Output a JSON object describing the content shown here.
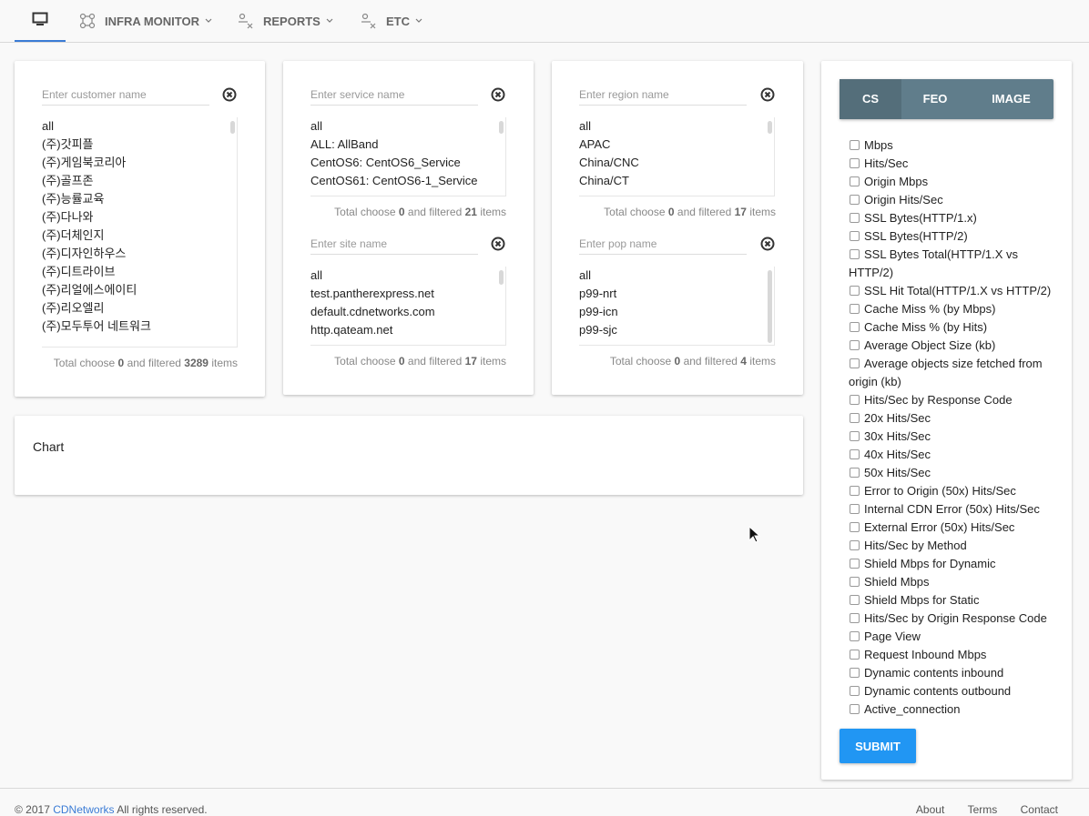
{
  "nav": {
    "home_icon": "monitor-icon",
    "items": [
      {
        "label": "INFRA MONITOR",
        "icon": "network-icon"
      },
      {
        "label": "REPORTS",
        "icon": "reports-icon"
      },
      {
        "label": "ETC",
        "icon": "etc-icon"
      }
    ],
    "accent": "#3a7bd5"
  },
  "customer": {
    "placeholder": "Enter customer name",
    "items": [
      "all",
      "(주)갓피플",
      "(주)게임북코리아",
      "(주)골프존",
      "(주)능률교육",
      "(주)다나와",
      "(주)더체인지",
      "(주)디자인하우스",
      "(주)디트라이브",
      "(주)리얼에스에이티",
      "(주)리오엘리",
      "(주)모두투어 네트워크"
    ],
    "footer_prefix": "Total choose",
    "chosen": "0",
    "footer_mid": "and filtered",
    "filtered": "3289",
    "footer_suffix": "items"
  },
  "service": {
    "placeholder": "Enter service name",
    "items": [
      "all",
      "ALL: AllBand",
      "CentOS6: CentOS6_Service",
      "CentOS61: CentOS6-1_Service"
    ],
    "footer_prefix": "Total choose",
    "chosen": "0",
    "footer_mid": "and filtered",
    "filtered": "21",
    "footer_suffix": "items"
  },
  "site": {
    "placeholder": "Enter site name",
    "items": [
      "all",
      "test.pantherexpress.net",
      "default.cdnetworks.com",
      "http.qateam.net"
    ],
    "footer_prefix": "Total choose",
    "chosen": "0",
    "footer_mid": "and filtered",
    "filtered": "17",
    "footer_suffix": "items"
  },
  "region": {
    "placeholder": "Enter region name",
    "items": [
      "all",
      "APAC",
      "China/CNC",
      "China/CT"
    ],
    "footer_prefix": "Total choose",
    "chosen": "0",
    "footer_mid": "and filtered",
    "filtered": "17",
    "footer_suffix": "items"
  },
  "pop": {
    "placeholder": "Enter pop name",
    "items": [
      "all",
      "p99-nrt",
      "p99-icn",
      "p99-sjc"
    ],
    "footer_prefix": "Total choose",
    "chosen": "0",
    "footer_mid": "and filtered",
    "filtered": "4",
    "footer_suffix": "items"
  },
  "chart": {
    "title": "Chart"
  },
  "tabs": [
    "CS",
    "FEO",
    "IMAGE"
  ],
  "tab_colors": {
    "bar": "#607d8b",
    "active": "#546e7a"
  },
  "metrics": [
    "Mbps",
    "Hits/Sec",
    "Origin Mbps",
    "Origin Hits/Sec",
    "SSL Bytes(HTTP/1.x)",
    "SSL Bytes(HTTP/2)",
    "SSL Bytes Total(HTTP/1.X vs HTTP/2)",
    "SSL Hit Total(HTTP/1.X vs HTTP/2)",
    "Cache Miss % (by Mbps)",
    "Cache Miss % (by Hits)",
    "Average Object Size (kb)",
    "Average objects size fetched from origin (kb)",
    "Hits/Sec by Response Code",
    "20x Hits/Sec",
    "30x Hits/Sec",
    "40x Hits/Sec",
    "50x Hits/Sec",
    "Error to Origin (50x) Hits/Sec",
    "Internal CDN Error (50x) Hits/Sec",
    "External Error (50x) Hits/Sec",
    "Hits/Sec by Method",
    "Shield Mbps for Dynamic",
    "Shield Mbps",
    "Shield Mbps for Static",
    "Hits/Sec by Origin Response Code",
    "Page View",
    "Request Inbound Mbps",
    "Dynamic contents inbound",
    "Dynamic contents outbound",
    "Active_connection"
  ],
  "submit_label": "SUBMIT",
  "submit_color": "#2196f3",
  "footer": {
    "copyright_prefix": "© 2017",
    "company": "CDNetworks",
    "copyright_suffix": "All rights reserved.",
    "links": [
      "About",
      "Terms",
      "Contact"
    ]
  }
}
